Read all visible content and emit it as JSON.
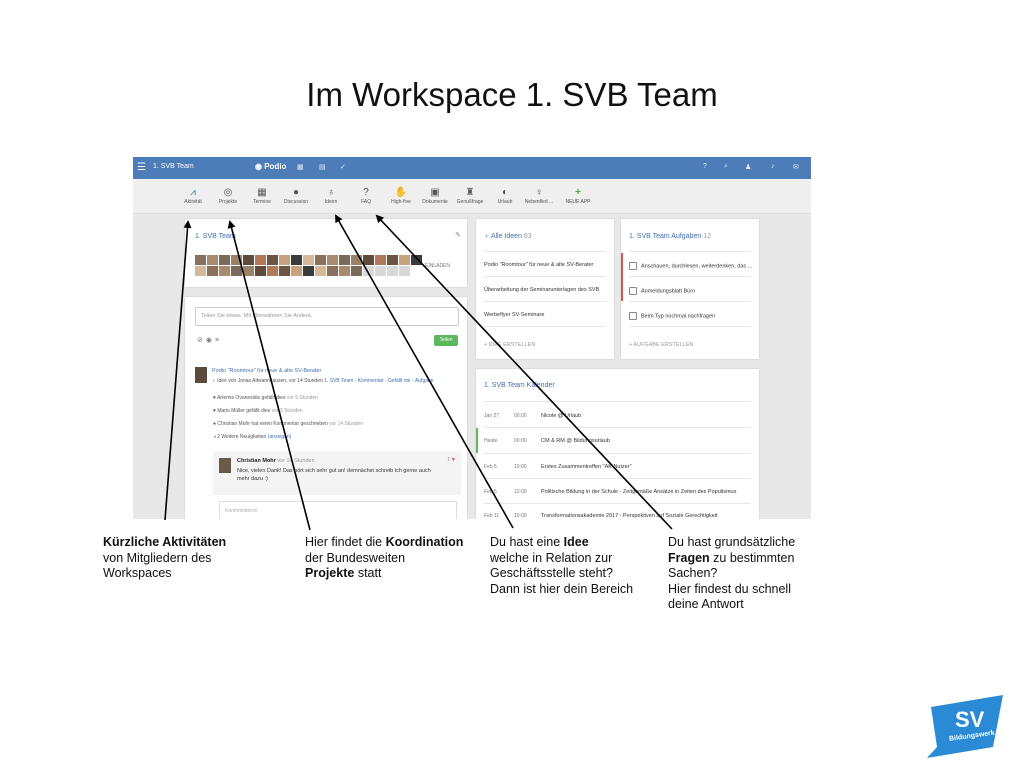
{
  "slide": {
    "title": "Im Workspace 1. SVB Team"
  },
  "podio": {
    "topbar": {
      "workspace": "SVB Team",
      "logo": "Podio"
    },
    "apps": [
      {
        "label": "Aktivität",
        "icon": "activity-icon"
      },
      {
        "label": "Projekte",
        "icon": "globe-icon"
      },
      {
        "label": "Termine",
        "icon": "calendar-icon"
      },
      {
        "label": "Discussion",
        "icon": "chat-icon"
      },
      {
        "label": "Ideen",
        "icon": "lightbulb-icon"
      },
      {
        "label": "FAQ",
        "icon": "question-icon"
      },
      {
        "label": "High-five",
        "icon": "hand-icon"
      },
      {
        "label": "Dokumente",
        "icon": "documents-icon"
      },
      {
        "label": "Genußfrage",
        "icon": "cake-icon"
      },
      {
        "label": "Urlaub",
        "icon": "globe-icon"
      },
      {
        "label": "Nebenfled ...",
        "icon": "bulb-icon"
      },
      {
        "label": "NEUE APP",
        "icon": "plus-icon"
      }
    ],
    "team_card": {
      "title": "1. SVB Team",
      "invite": "EINLADEN"
    },
    "stream": {
      "share_placeholder": "Teilen Sie etwas. Mit @erwähnen Sie Andere.",
      "share_button": "Teilen",
      "post_title": "Podio \"Roomtour\" für neue & alte SV-Berater",
      "post_meta_prefix": "Idee von Jonas Altwannkausen, vor 14 Stunden",
      "post_meta_link": "1. SVB Team",
      "post_meta_rest": "- Kommentar - Gefällt mir - Aufgabe",
      "likes": [
        {
          "text": "Artemis Ovanesidis gefällt dies",
          "time": "vor 5 Stunden"
        },
        {
          "text": "Mario Müller gefällt dies",
          "time": "vor 3 Stunden"
        },
        {
          "text": "Christian Mohr hat einen Kommentar geschrieben",
          "time": "vor 14 Stunden"
        },
        {
          "text": "2 Weitere Neuigkeiten",
          "time": "(anzeigen)"
        }
      ],
      "comment_author": "Christian Mohr",
      "comment_meta": "vor 14 Stunden",
      "comment_count": "1",
      "comment_text": "Nice, vielen Dank! Das hört sich sehr gut an! demnächst schreib ich gerne auch mehr dazu :)",
      "comment_placeholder": "Kommentieren"
    },
    "ideas": {
      "title": "Alle Ideen",
      "count": "63",
      "items": [
        "Podio \"Roomtour\" für neue & alte SV-Berater",
        "Überarbeitung der Seminarunterlagen des SVB",
        "Werbeflyer SV-Seminare"
      ],
      "create": "+ IDEE ERSTELLEN"
    },
    "tasks": {
      "title": "1. SVB Team Aufgaben",
      "count": "12",
      "items": [
        "Anschauen, durchlesen, weiterdenken, das ...",
        "Anmeldungsblatt Büro",
        "Beim Typ nochmal nachfragen"
      ],
      "create": "+ AUFGABE ERSTELLEN"
    },
    "calendar": {
      "title": "1. SVB Team Kalender",
      "events": [
        {
          "date": "Jan 27",
          "time": "00:00",
          "event": "Nicole @ Urlaub"
        },
        {
          "date": "Heute",
          "time": "00:00",
          "event": "CM & RM @ Bildungsurlaub"
        },
        {
          "date": "Feb 5",
          "time": "10:00",
          "event": "Erstes Zusammentreffen \"AK Nutzer\""
        },
        {
          "date": "Feb 5",
          "time": "12:00",
          "event": "Politische Bildung in der Schule - Zeitgemäße Ansätze in Zeiten des Populismus"
        },
        {
          "date": "Feb 11",
          "time": "10:00",
          "event": "Transformationsakademie 2017 - Perspektiven auf Soziale Gerechtigkeit"
        }
      ]
    }
  },
  "captions": [
    {
      "bold": "Kürzliche Aktivitäten",
      "rest": "von Mitgliedern des Workspaces"
    },
    {
      "pre": "Hier findet die ",
      "bold": "Koordination",
      "mid": " der Bundesweiten ",
      "bold2": "Projekte",
      "post": " statt"
    },
    {
      "pre": "Du hast eine ",
      "bold": "Idee",
      "line2": "welche in Relation zur",
      "line3": "Geschäftsstelle steht?",
      "line4": "Dann ist hier dein Bereich"
    },
    {
      "line1": "Du hast grundsätzliche",
      "bold": "Fragen",
      "mid": " zu bestimmten",
      "line3": "Sachen?",
      "line4": "Hier findest du schnell",
      "line5": "deine Antwort"
    }
  ],
  "logo": {
    "text": "SV",
    "subtext": "Bildungswerk",
    "color": "#2b8ad6"
  }
}
